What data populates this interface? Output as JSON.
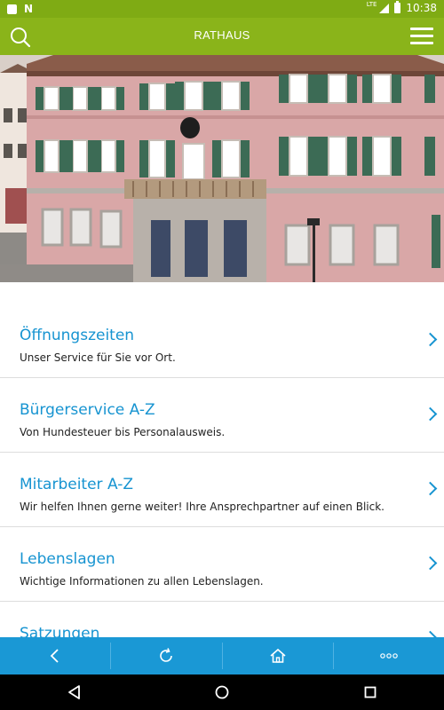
{
  "status_bar": {
    "network_type": "LTE",
    "time": "10:38",
    "icons": [
      "notification-square-icon",
      "n-app-icon",
      "signal-icon",
      "battery-icon"
    ]
  },
  "header": {
    "title": "RATHAUS",
    "search_icon": "search-icon",
    "menu_icon": "hamburger-menu-icon"
  },
  "hero": {
    "image_subject": "town-hall-building-photo"
  },
  "menu": {
    "items": [
      {
        "title": "Öffnungszeiten",
        "subtitle": "Unser Service für Sie vor Ort."
      },
      {
        "title": "Bürgerservice A-Z",
        "subtitle": "Von Hundesteuer bis Personalausweis."
      },
      {
        "title": "Mitarbeiter A-Z",
        "subtitle": "Wir helfen Ihnen gerne weiter! Ihre Ansprechpartner auf einen Blick."
      },
      {
        "title": "Lebenslagen",
        "subtitle": "Wichtige Informationen zu allen Lebenslagen."
      },
      {
        "title": "Satzungen",
        "subtitle": ""
      }
    ]
  },
  "toolbar": {
    "buttons": [
      "back-icon",
      "reload-icon",
      "home-icon",
      "more-icon"
    ]
  },
  "system_nav": {
    "buttons": [
      "nav-back-icon",
      "nav-home-icon",
      "nav-recents-icon"
    ]
  },
  "colors": {
    "status_bar": "#7fab14",
    "app_bar": "#8ab41a",
    "accent": "#1794d1",
    "toolbar": "#1a98d5"
  }
}
